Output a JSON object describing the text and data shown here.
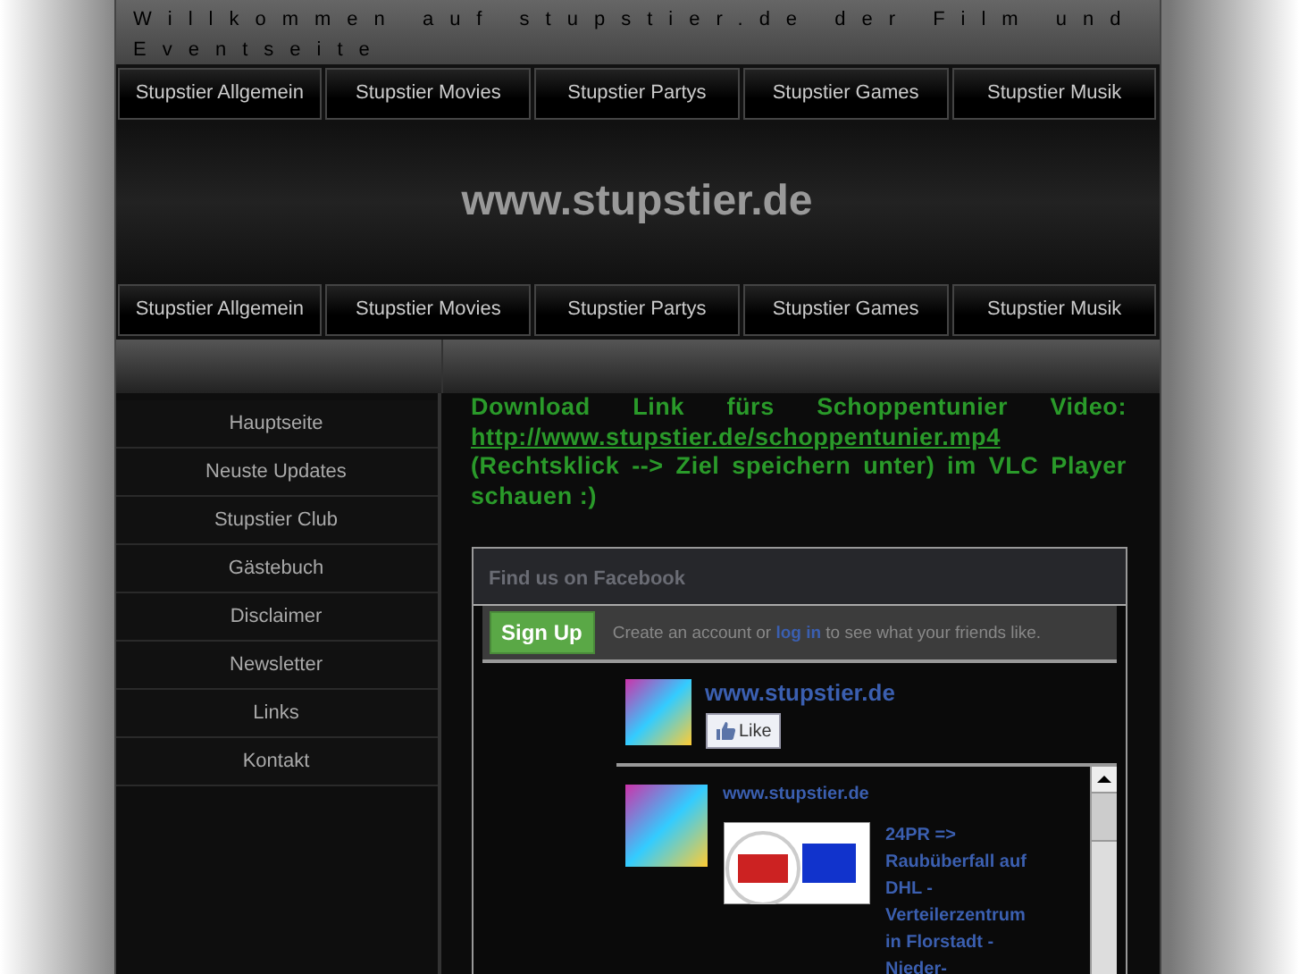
{
  "header": {
    "title": "Willkommen auf stupstier.de der Film und Eventseite"
  },
  "top_nav": [
    "Stupstier Allgemein",
    "Stupstier Movies",
    "Stupstier Partys",
    "Stupstier Games",
    "Stupstier Musik"
  ],
  "banner": {
    "title": "www.stupstier.de"
  },
  "bottom_nav": [
    "Stupstier Allgemein",
    "Stupstier Movies",
    "Stupstier Partys",
    "Stupstier Games",
    "Stupstier Musik"
  ],
  "sidebar": {
    "items": [
      "Hauptseite",
      "Neuste Updates",
      "Stupstier Club",
      "Gästebuch",
      "Disclaimer",
      "Newsletter",
      "Links",
      "Kontakt"
    ]
  },
  "content": {
    "text_before": "Download Link fürs Schoppentunier Video:",
    "link": "http://www.stupstier.de/schoppentunier.mp4",
    "text_after": "(Rechtsklick --> Ziel speichern unter) im VLC Player schauen :)"
  },
  "facebook": {
    "title": "Find us on Facebook",
    "signup": "Sign Up",
    "prompt_before": "Create an account or",
    "prompt_link": "log in",
    "prompt_after": "to see what your friends like.",
    "page_name": "www.stupstier.de",
    "like": "Like",
    "post": {
      "author": "www.stupstier.de",
      "text": "24PR => Raubüberfall auf DHL - Verteilerzentrum in Florstadt - Nieder-"
    }
  }
}
